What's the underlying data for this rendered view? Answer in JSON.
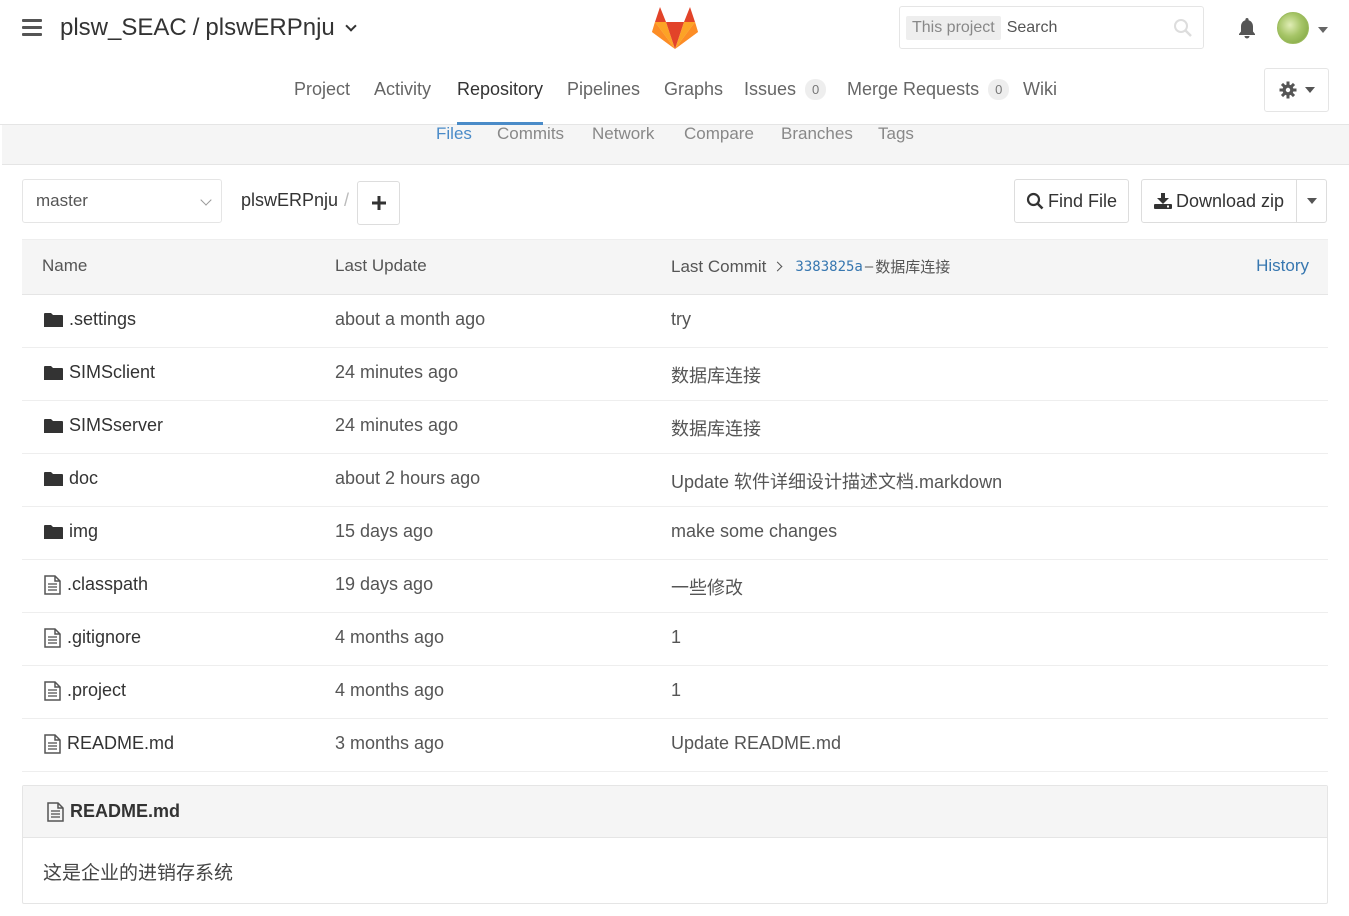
{
  "header": {
    "namespace": "plsw_SEAC",
    "separator": "/",
    "project": "plswERPnju",
    "search": {
      "scope": "This project",
      "placeholder": "Search"
    }
  },
  "nav": {
    "project": "Project",
    "activity": "Activity",
    "repository": "Repository",
    "pipelines": "Pipelines",
    "graphs": "Graphs",
    "issues": "Issues",
    "issues_count": "0",
    "merge_requests": "Merge Requests",
    "merge_requests_count": "0",
    "wiki": "Wiki"
  },
  "subnav": {
    "files": "Files",
    "commits": "Commits",
    "network": "Network",
    "compare": "Compare",
    "branches": "Branches",
    "tags": "Tags"
  },
  "tree_controls": {
    "branch": "master",
    "path": "plswERPnju",
    "path_sep": "/",
    "find_file": "Find File",
    "download_zip": "Download zip"
  },
  "table": {
    "headers": {
      "name": "Name",
      "last_update": "Last Update",
      "last_commit": "Last Commit",
      "commit_sha": "3383825a",
      "commit_dash": "–",
      "commit_message": "数据库连接",
      "history": "History"
    },
    "rows": [
      {
        "name": ".settings",
        "type": "folder",
        "updated": "about a month ago",
        "message": "try"
      },
      {
        "name": "SIMSclient",
        "type": "folder",
        "updated": "24 minutes ago",
        "message": "数据库连接"
      },
      {
        "name": "SIMSserver",
        "type": "folder",
        "updated": "24 minutes ago",
        "message": "数据库连接"
      },
      {
        "name": "doc",
        "type": "folder",
        "updated": "about 2 hours ago",
        "message": "Update 软件详细设计描述文档.markdown"
      },
      {
        "name": "img",
        "type": "folder",
        "updated": "15 days ago",
        "message": "make some changes"
      },
      {
        "name": ".classpath",
        "type": "file",
        "updated": "19 days ago",
        "message": "一些修改"
      },
      {
        "name": ".gitignore",
        "type": "file",
        "updated": "4 months ago",
        "message": "1"
      },
      {
        "name": ".project",
        "type": "file",
        "updated": "4 months ago",
        "message": "1"
      },
      {
        "name": "README.md",
        "type": "file",
        "updated": "3 months ago",
        "message": "Update README.md"
      }
    ]
  },
  "readme": {
    "title": "README.md",
    "content": "这是企业的进销存系统"
  },
  "colors": {
    "link": "#3777b0",
    "active_tab": "#4a8bc8",
    "subnav_bg": "#f5f5f5"
  }
}
